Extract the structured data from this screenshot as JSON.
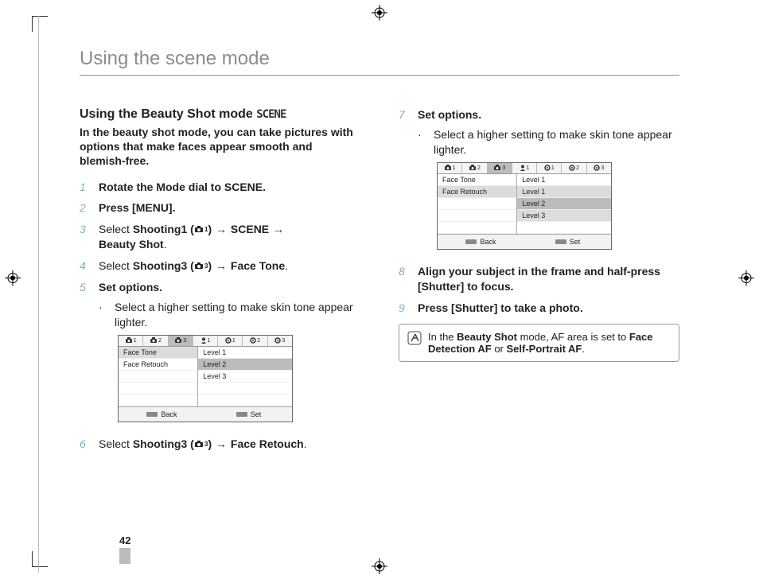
{
  "page_title": "Using the scene mode",
  "page_number": "42",
  "heading": "Using the Beauty Shot mode",
  "heading_mode_label": "SCENE",
  "subheading": "In the beauty shot mode, you can take pictures with options that make faces appear smooth and blemish-free.",
  "steps": {
    "s1": {
      "num": "1",
      "body_pre": "Rotate the Mode dial to ",
      "mode": "SCENE",
      "body_post": "."
    },
    "s2": {
      "num": "2",
      "pre": "Press ",
      "bold": "[MENU]",
      "post": "."
    },
    "s3": {
      "num": "3",
      "pre": "Select ",
      "b1": "Shooting1 (",
      "icon_sub": "1",
      "b1post": ")",
      "arrow": "→",
      "b2": "SCENE",
      "b3": "Beauty Shot",
      "post": "."
    },
    "s4": {
      "num": "4",
      "pre": "Select ",
      "b1": "Shooting3 (",
      "icon_sub": "3",
      "b1post": ")",
      "arrow": "→",
      "b2": "Face Tone",
      "post": "."
    },
    "s5": {
      "num": "5",
      "text": "Set options.",
      "bullet": "Select a higher setting to make skin tone appear lighter."
    },
    "s6": {
      "num": "6",
      "pre": "Select ",
      "b1": "Shooting3 (",
      "icon_sub": "3",
      "b1post": ")",
      "arrow": "→",
      "b2": "Face Retouch",
      "post": "."
    },
    "s7": {
      "num": "7",
      "text": "Set options.",
      "bullet": "Select a higher setting to make skin tone appear lighter."
    },
    "s8": {
      "num": "8",
      "pre": "Align your subject in the frame and half-press ",
      "bold": "[Shutter]",
      "post": " to focus."
    },
    "s9": {
      "num": "9",
      "pre": "Press ",
      "bold": "[Shutter]",
      "post": " to take a photo."
    }
  },
  "menu1": {
    "tabs": [
      {
        "icon": "camera",
        "sub": "1"
      },
      {
        "icon": "camera",
        "sub": "2"
      },
      {
        "icon": "camera",
        "sub": "3",
        "selected": true
      },
      {
        "icon": "person",
        "sub": "1"
      },
      {
        "icon": "gear",
        "sub": "1"
      },
      {
        "icon": "gear",
        "sub": "2"
      },
      {
        "icon": "gear",
        "sub": "3"
      }
    ],
    "left_rows": [
      "Face Tone",
      "Face Retouch"
    ],
    "right_rows": [
      "Level 1",
      "Level 2",
      "Level 3"
    ],
    "left_sel": 0,
    "right_sel": 1,
    "footer_back": "Back",
    "footer_set": "Set"
  },
  "menu2": {
    "tabs": [
      {
        "icon": "camera",
        "sub": "1"
      },
      {
        "icon": "camera",
        "sub": "2"
      },
      {
        "icon": "camera",
        "sub": "3",
        "selected": true
      },
      {
        "icon": "person",
        "sub": "1"
      },
      {
        "icon": "gear",
        "sub": "1"
      },
      {
        "icon": "gear",
        "sub": "2"
      },
      {
        "icon": "gear",
        "sub": "3"
      }
    ],
    "left_rows": [
      "Face Tone",
      "Face Retouch"
    ],
    "right_rows": [
      "Level 1",
      "Level 1",
      "Level 2",
      "Level 3"
    ],
    "left_sel": 1,
    "right_sel_start": 1,
    "right_sel_strong": 2,
    "footer_back": "Back",
    "footer_set": "Set"
  },
  "note": {
    "pre": "In the ",
    "b1": "Beauty Shot",
    "mid": " mode, AF area is set to ",
    "b2": "Face Detection AF",
    "or": " or ",
    "b3": "Self-Portrait AF",
    "post": "."
  }
}
